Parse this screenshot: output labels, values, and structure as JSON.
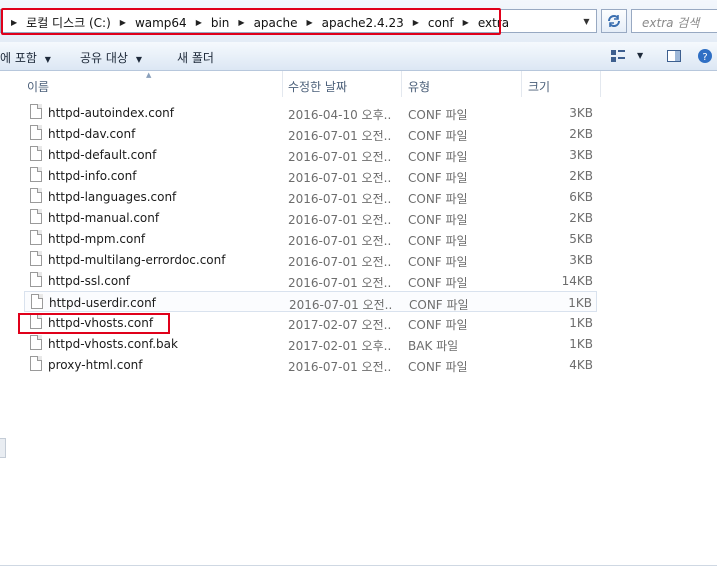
{
  "address": {
    "breadcrumbs": [
      "로컬 디스크 (C:)",
      "wamp64",
      "bin",
      "apache",
      "apache2.4.23",
      "conf",
      "extra"
    ]
  },
  "search": {
    "placeholder": "extra 검색"
  },
  "toolbar": {
    "include_label": "에 포함",
    "share_label": "공유 대상",
    "new_folder_label": "새 폴더"
  },
  "columns": {
    "name": "이름",
    "date": "수정한 날짜",
    "type": "유형",
    "size": "크기"
  },
  "files": [
    {
      "name": "httpd-autoindex.conf",
      "date": "2016-04-10 오후...",
      "type": "CONF 파일",
      "size": "3KB"
    },
    {
      "name": "httpd-dav.conf",
      "date": "2016-07-01 오전...",
      "type": "CONF 파일",
      "size": "2KB"
    },
    {
      "name": "httpd-default.conf",
      "date": "2016-07-01 오전...",
      "type": "CONF 파일",
      "size": "3KB"
    },
    {
      "name": "httpd-info.conf",
      "date": "2016-07-01 오전...",
      "type": "CONF 파일",
      "size": "2KB"
    },
    {
      "name": "httpd-languages.conf",
      "date": "2016-07-01 오전...",
      "type": "CONF 파일",
      "size": "6KB"
    },
    {
      "name": "httpd-manual.conf",
      "date": "2016-07-01 오전...",
      "type": "CONF 파일",
      "size": "2KB"
    },
    {
      "name": "httpd-mpm.conf",
      "date": "2016-07-01 오전...",
      "type": "CONF 파일",
      "size": "5KB"
    },
    {
      "name": "httpd-multilang-errordoc.conf",
      "date": "2016-07-01 오전...",
      "type": "CONF 파일",
      "size": "3KB"
    },
    {
      "name": "httpd-ssl.conf",
      "date": "2016-07-01 오전...",
      "type": "CONF 파일",
      "size": "14KB"
    },
    {
      "name": "httpd-userdir.conf",
      "date": "2016-07-01 오전...",
      "type": "CONF 파일",
      "size": "1KB"
    },
    {
      "name": "httpd-vhosts.conf",
      "date": "2017-02-07 오전...",
      "type": "CONF 파일",
      "size": "1KB"
    },
    {
      "name": "httpd-vhosts.conf.bak",
      "date": "2017-02-01 오후...",
      "type": "BAK 파일",
      "size": "1KB"
    },
    {
      "name": "proxy-html.conf",
      "date": "2016-07-01 오전...",
      "type": "CONF 파일",
      "size": "4KB"
    }
  ],
  "colors": {
    "highlight": "#e0001a",
    "header_text": "#4c607a"
  }
}
